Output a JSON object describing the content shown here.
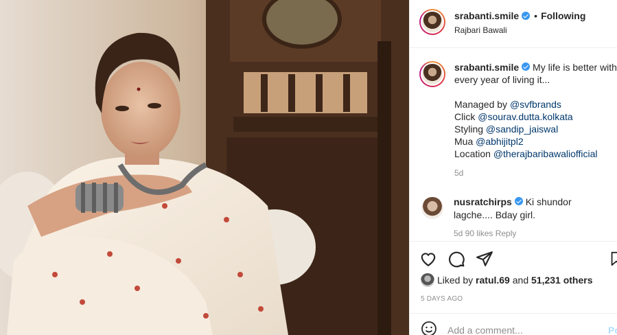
{
  "header": {
    "username": "srabanti.smile",
    "follow_status": "Following",
    "separator": "•",
    "location": "Rajbari Bawali"
  },
  "caption": {
    "username": "srabanti.smile",
    "text": "My life is better with every year of living it...",
    "line1_prefix": "Managed by ",
    "line1_mention": "@svfbrands",
    "line2_prefix": "Click ",
    "line2_mention": "@sourav.dutta.kolkata",
    "line3_prefix": "Styling ",
    "line3_mention": "@sandip_jaiswal",
    "line4_prefix": "Mua ",
    "line4_mention": "@abhijitpl2",
    "line5_prefix": "Location ",
    "line5_mention": "@therajbaribawaliofficial",
    "age": "5d"
  },
  "comment": {
    "username": "nusratchirps",
    "text": "Ki shundor lagche.... Bday girl.",
    "meta": "5d   90 likes   Reply"
  },
  "likes": {
    "prefix": "Liked by",
    "user": "ratul.69",
    "middle": "and",
    "count": "51,231 others"
  },
  "date": "5 DAYS AGO",
  "add_comment": {
    "placeholder": "Add a comment...",
    "post_label": "Po"
  },
  "icons": [
    "heart-icon",
    "comment-icon",
    "share-icon",
    "bookmark-icon",
    "smile-icon",
    "verified-icon"
  ],
  "colors": {
    "link": "#00376b",
    "verified": "#3897f0",
    "muted": "#8e8e8e"
  }
}
